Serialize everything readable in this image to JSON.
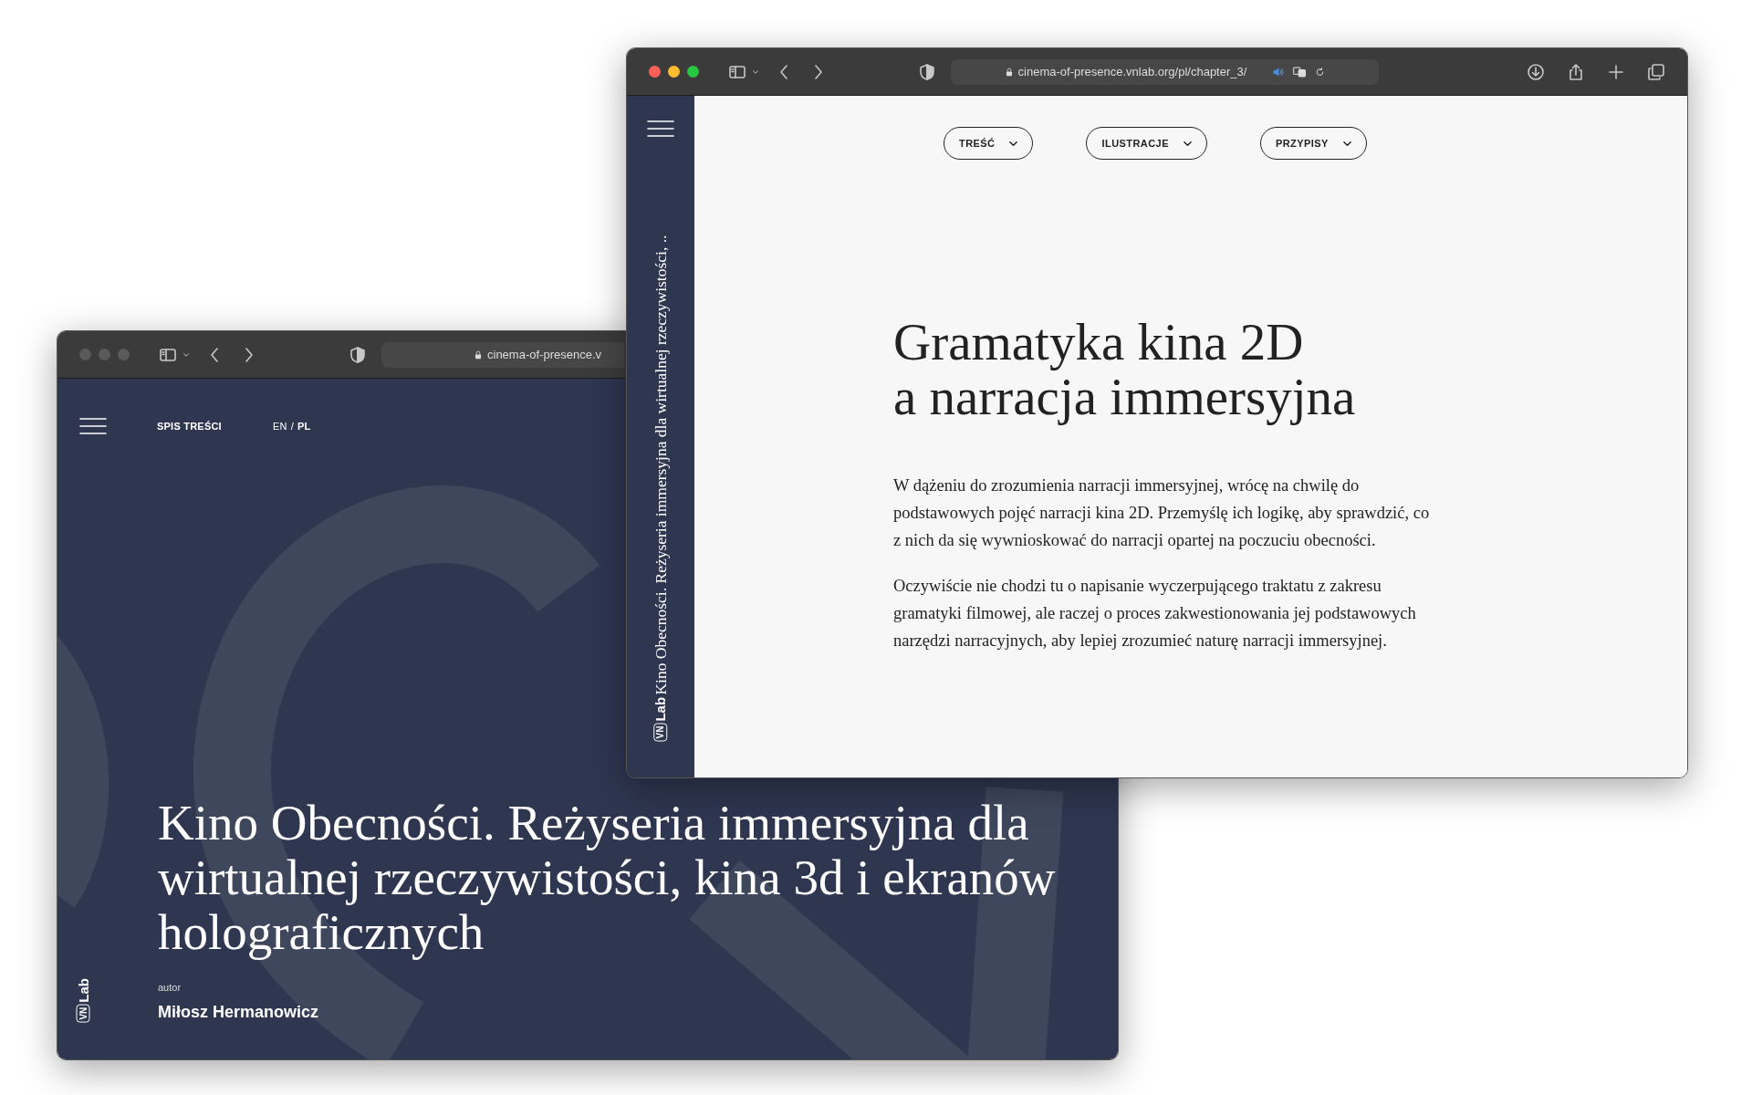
{
  "windows": [
    {
      "kind": "cover",
      "active": false,
      "toolbar": {
        "url": "cinema-of-presence.v"
      },
      "nav": {
        "menu_label": "SPIS TREŚCI",
        "separator": "/",
        "languages": [
          {
            "label": "EN",
            "selected": false
          },
          {
            "label": "PL",
            "selected": true
          }
        ]
      },
      "title": "Kino Obecności. Reżyseria immersyjna dla wirtualnej rzeczywistości, kina 3d i ekranów holograficznych",
      "author_label": "autor",
      "author": "Miłosz Hermanowicz",
      "logo": {
        "boxed": "VN",
        "text": "Lab"
      }
    },
    {
      "kind": "chapter",
      "active": true,
      "toolbar": {
        "url": "cinema-of-presence.vnlab.org/pl/chapter_3/"
      },
      "sidebar": {
        "logo": {
          "boxed": "VN",
          "text": "Lab"
        },
        "book_title": "Kino Obecności. Reżyseria immersyjna dla wirtualnej rzeczywistości, .."
      },
      "menus": [
        {
          "label": "TREŚĆ"
        },
        {
          "label": "ILUSTRACJE"
        },
        {
          "label": "PRZYPISY"
        }
      ],
      "heading": [
        "Gramatyka kina 2D",
        "a narracja immersyjna"
      ],
      "paragraphs": [
        "W dążeniu do zrozumienia narracji immersyjnej, wrócę na chwilę do podstawowych pojęć narracji kina 2D. Przemyślę ich logikę, aby sprawdzić, co z nich da się wywnioskować do narracji opartej na poczuciu obecności.",
        "Oczywiście nie chodzi tu o napisanie wyczerpującego traktatu z zakresu gramatyki filmowej, ale raczej o proces zakwestionowania jej podstawowych narzędzi narracyjnych, aby lepiej zrozumieć naturę narracji immersyjnej."
      ]
    }
  ]
}
